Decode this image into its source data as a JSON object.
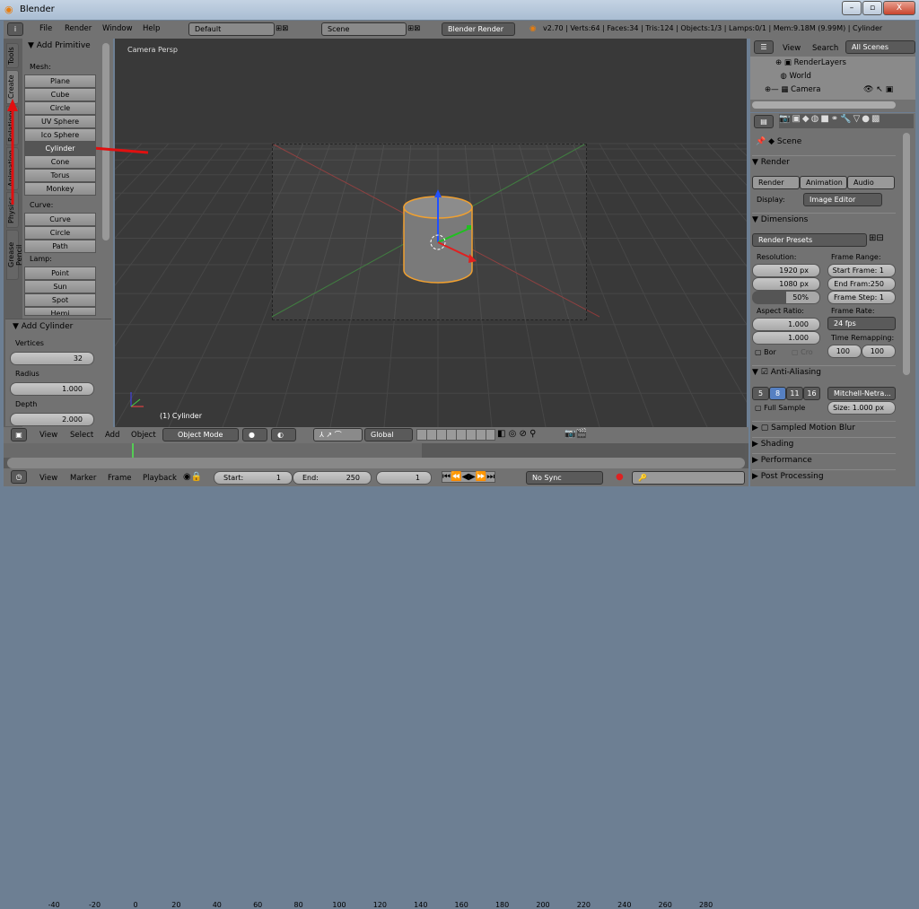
{
  "window": {
    "title": "Blender",
    "min": "–",
    "max": "▫",
    "close": "X"
  },
  "topbar": {
    "menus": [
      "File",
      "Render",
      "Window",
      "Help"
    ],
    "layout": "Default",
    "scene": "Scene",
    "engine": "Blender Render",
    "stats": "v2.70 | Verts:64 | Faces:34 | Tris:124 | Objects:1/3 | Lamps:0/1 | Mem:9.18M (9.99M) | Cylinder"
  },
  "tools": {
    "tabs": [
      "Tools",
      "Create",
      "Relations",
      "Animation",
      "Physics",
      "Grease Pencil"
    ],
    "panel_title": "Add Primitive",
    "mesh_label": "Mesh:",
    "mesh": [
      "Plane",
      "Cube",
      "Circle",
      "UV Sphere",
      "Ico Sphere",
      "Cylinder",
      "Cone",
      "Torus",
      "Monkey"
    ],
    "curve_label": "Curve:",
    "curve": [
      "Curve",
      "Circle",
      "Path"
    ],
    "lamp_label": "Lamp:",
    "lamp": [
      "Point",
      "Sun",
      "Spot",
      "Hemi"
    ],
    "selected": "Cylinder"
  },
  "operator": {
    "title": "Add Cylinder",
    "fields": [
      {
        "label": "Vertices",
        "value": "32"
      },
      {
        "label": "Radius",
        "value": "1.000"
      },
      {
        "label": "Depth",
        "value": "2.000"
      }
    ]
  },
  "viewport": {
    "view_label": "Camera Persp",
    "object_label": "(1) Cylinder"
  },
  "view3d_header": {
    "menus": [
      "View",
      "Select",
      "Add",
      "Object"
    ],
    "mode": "Object Mode",
    "orientation": "Global"
  },
  "timeline": {
    "ticks": [
      "-40",
      "-20",
      "0",
      "20",
      "40",
      "60",
      "80",
      "100",
      "120",
      "140",
      "160",
      "180",
      "200",
      "220",
      "240",
      "260",
      "280"
    ],
    "current_frame": 0,
    "menus": [
      "View",
      "Marker",
      "Frame",
      "Playback"
    ],
    "start_label": "Start:",
    "start": "1",
    "end_label": "End:",
    "end": "250",
    "frame": "1",
    "sync": "No Sync"
  },
  "outliner": {
    "menus": [
      "View",
      "Search"
    ],
    "filter": "All Scenes",
    "items": [
      "RenderLayers",
      "World",
      "Camera"
    ]
  },
  "properties": {
    "context": "Scene",
    "render": {
      "title": "Render",
      "buttons": [
        "Render",
        "Animation",
        "Audio"
      ],
      "display_label": "Display:",
      "display": "Image Editor"
    },
    "dimensions": {
      "title": "Dimensions",
      "presets": "Render Presets",
      "resolution_label": "Resolution:",
      "res_x": "1920 px",
      "res_y": "1080 px",
      "res_pct": "50%",
      "frame_range_label": "Frame Range:",
      "start": "Start Frame: 1",
      "end": "End Fram:250",
      "step": "Frame Step: 1",
      "aspect_label": "Aspect Ratio:",
      "asp_x": "1.000",
      "asp_y": "1.000",
      "frame_rate_label": "Frame Rate:",
      "fps": "24 fps",
      "time_remap_label": "Time Remapping:",
      "remap_old": "100",
      "remap_new": "100",
      "border": "Bor",
      "crop": "Cro"
    },
    "aa": {
      "title": "Anti-Aliasing",
      "samples": [
        "5",
        "8",
        "11",
        "16"
      ],
      "selected": "8",
      "filter": "Mitchell-Netra...",
      "full_sample": "Full Sample",
      "size": "Size: 1.000 px"
    },
    "collapsed": [
      "Sampled Motion Blur",
      "Shading",
      "Performance",
      "Post Processing"
    ]
  }
}
